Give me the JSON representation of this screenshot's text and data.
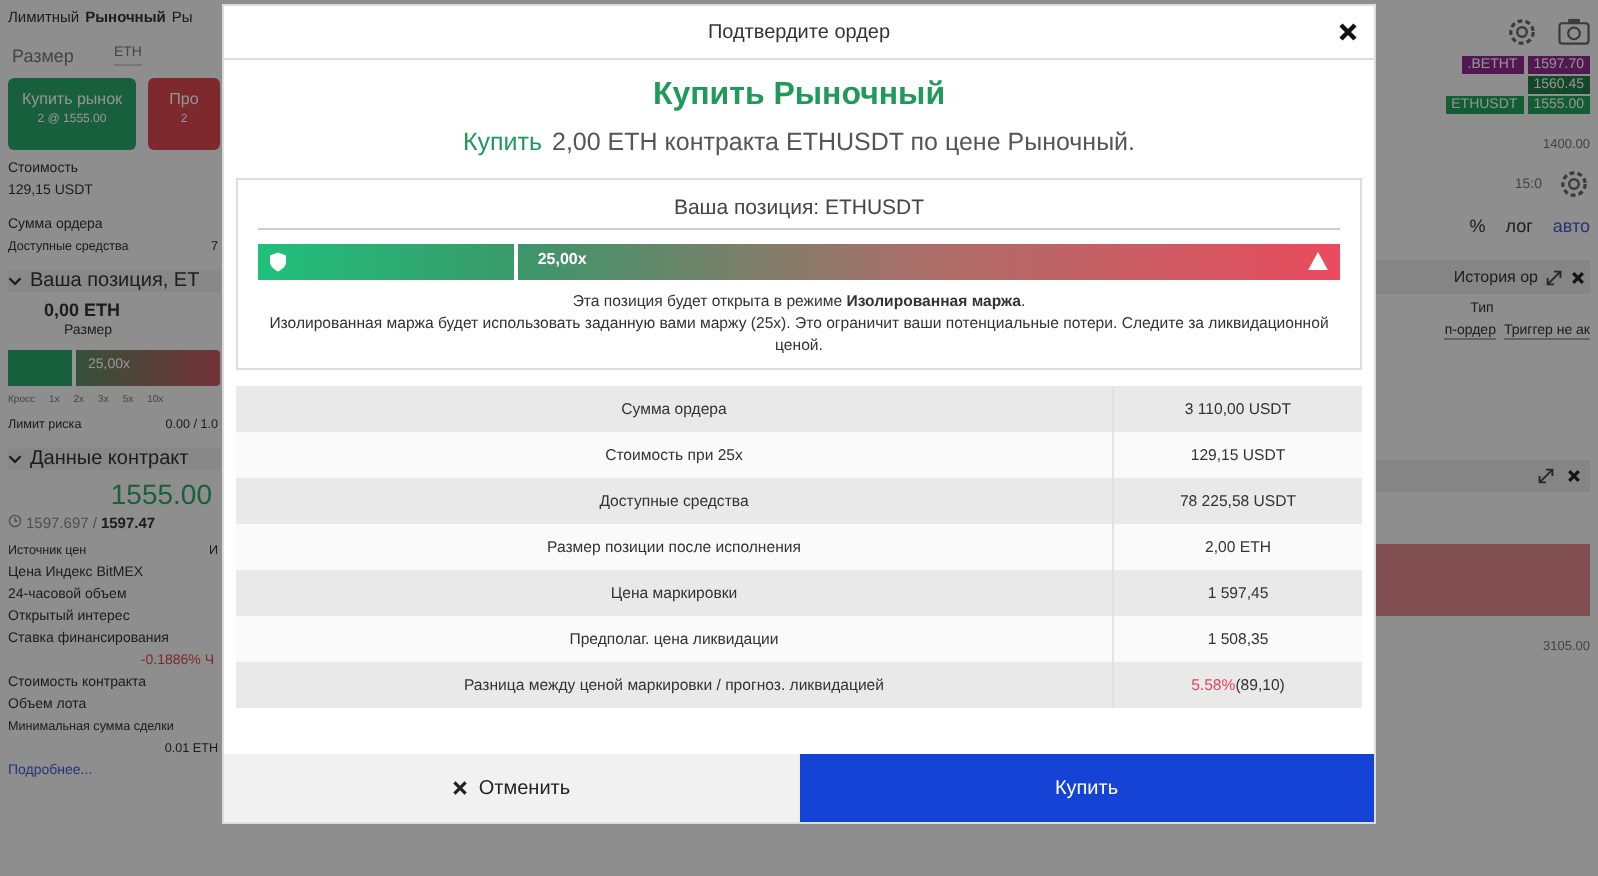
{
  "background": {
    "left": {
      "tabs": [
        {
          "label": "Лимитный",
          "selected": false
        },
        {
          "label": "Рыночный",
          "selected": true
        },
        {
          "label": "Ры",
          "selected": false
        }
      ],
      "size_label": "Размер",
      "size_unit": "ETH",
      "buy_button": {
        "label": "Купить рынок",
        "sub": "2 @ 1555.00"
      },
      "sell_button": {
        "label": "Про",
        "sub": "2"
      },
      "cost_label": "Стоимость",
      "cost_value": "129,15 USDT",
      "order_sum_label": "Сумма ордера",
      "available_label": "Доступные средства",
      "available_value": "7",
      "position_header": "Ваша позиция, ET",
      "position_size": "0,00 ETH",
      "position_size_label": "Размер",
      "leverage_label": "25,00x",
      "slider_ticks": [
        "Кросс",
        "1x",
        "2x",
        "3x",
        "5x",
        "10x"
      ],
      "risk_label": "Лимит риска",
      "risk_value": "0.00 / 1.0",
      "contract_header": "Данные контракт",
      "last_price": "1555.00",
      "mark_index": "1597.697 /",
      "mark_index_bold": "1597.47",
      "contract_rows": [
        {
          "kind": "pair",
          "label": "Источник цен",
          "value": "И"
        },
        {
          "kind": "label",
          "label": "Цена Индекс BitMEX"
        },
        {
          "kind": "label",
          "label": "24-часовой объем"
        },
        {
          "kind": "label",
          "label": "Открытый интерес"
        },
        {
          "kind": "label",
          "label": "Ставка финансирования"
        },
        {
          "kind": "value",
          "value": "-0.1886% Ч"
        },
        {
          "kind": "label",
          "label": "Стоимость контракта"
        },
        {
          "kind": "label",
          "label": "Объем лота"
        },
        {
          "kind": "pair",
          "label": "Минимальная сумма сделки",
          "value": "0.01 ETH"
        }
      ],
      "more_link": "Подробнее..."
    },
    "right": {
      "price_tags": [
        {
          "kind": "index",
          "label": ".BETHT",
          "value": "1597.70"
        },
        {
          "kind": "bid",
          "value": "1560.45"
        },
        {
          "kind": "last",
          "label": "ETHUSDT",
          "value": "1555.00"
        }
      ],
      "axis_price": "1400.00",
      "time_label": "15:0",
      "scale_options": [
        {
          "label": "%",
          "selected": false
        },
        {
          "label": "лог",
          "selected": false
        },
        {
          "label": "авто",
          "selected": true
        }
      ],
      "panel_tab": "История ор",
      "column": "Тип",
      "cells": [
        "п-ордер",
        "Триггер не ак"
      ],
      "axis_value": "3105.00"
    }
  },
  "modal": {
    "title": "Подтвердите ордер",
    "heading": "Купить Рыночный",
    "subtitle_action": "Купить",
    "subtitle_rest": "2,00 ETH контракта ETHUSDT по цене Рыночный.",
    "position_title": "Ваша позиция: ETHUSDT",
    "leverage_label": "25,00x",
    "notice": "Эта позиция будет открыта в режиме **Изолированная маржа**.",
    "notice_detail": "Изолированная маржа будет использовать заданную вами маржу (25x). Это ограничит ваши потенциальные потери. Следите за ликвидационной ценой.",
    "rows": [
      {
        "label": "Сумма ордера",
        "value": "3 110,00 USDT"
      },
      {
        "label": "Стоимость при 25x",
        "value": "129,15 USDT"
      },
      {
        "label": "Доступные средства",
        "value": "78 225,58 USDT"
      },
      {
        "label": "Размер позиции после исполнения",
        "value": "2,00 ETH"
      },
      {
        "label": "Цена маркировки",
        "value": "1 597,45"
      },
      {
        "label": "Предполаг. цена ликвидации",
        "value": "1 508,35"
      },
      {
        "label": "Разница между ценой маркировки / прогноз. ликвидацией",
        "alert_value": "5.58%",
        "value": "(89,10)"
      }
    ],
    "cancel_button": "Отменить",
    "confirm_button": "Купить"
  }
}
